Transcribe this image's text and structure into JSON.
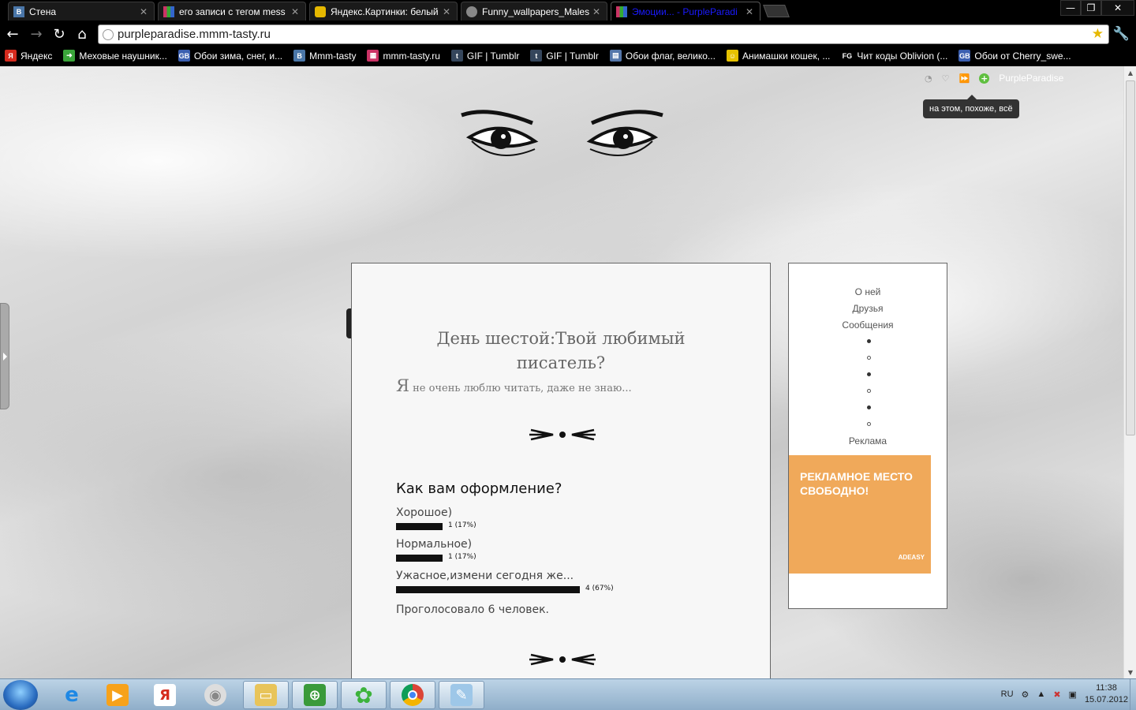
{
  "browser": {
    "tabs": [
      {
        "title": "Стена",
        "icon": "vk-icon",
        "color": "#4a76a8",
        "glyph": "В"
      },
      {
        "title": "его записи с тегом mess -",
        "icon": "mmm-tasty-icon",
        "color": "#cc3366",
        "glyph": ""
      },
      {
        "title": "Яндекс.Картинки: белый",
        "icon": "yandex-images-icon",
        "color": "#e6b800",
        "glyph": ""
      },
      {
        "title": "Funny_wallpapers_Males_a",
        "icon": "globe-icon",
        "color": "#888888",
        "glyph": ""
      },
      {
        "title": "Эмоции... - PurpleParadi",
        "icon": "mmm-tasty-icon",
        "color": "#cc3366",
        "glyph": ""
      }
    ],
    "address": "purpleparadise.mmm-tasty.ru",
    "bookmarks": [
      {
        "label": "Яндекс",
        "icon": "yandex-icon",
        "color": "#d52b1e",
        "glyph": "Я"
      },
      {
        "label": "Меховые наушник...",
        "icon": "green-arrow-icon",
        "color": "#3aa53a",
        "glyph": "➜"
      },
      {
        "label": "Обои зима, снег, и...",
        "icon": "wallpaper-site-icon",
        "color": "#3b5fb0",
        "glyph": "GB"
      },
      {
        "label": "Mmm-tasty",
        "icon": "vk-icon",
        "color": "#4a76a8",
        "glyph": "В"
      },
      {
        "label": "mmm-tasty.ru",
        "icon": "mmm-tasty-icon",
        "color": "#cc3366",
        "glyph": "▦"
      },
      {
        "label": "GIF | Tumblr",
        "icon": "tumblr-icon",
        "color": "#35465c",
        "glyph": "t"
      },
      {
        "label": "GIF | Tumblr",
        "icon": "tumblr-icon",
        "color": "#35465c",
        "glyph": "t"
      },
      {
        "label": "Обои флаг, велико...",
        "icon": "calendar-icon",
        "color": "#5577aa",
        "glyph": "▤"
      },
      {
        "label": "Анимашки кошек, ...",
        "icon": "smiley-icon",
        "color": "#e6c200",
        "glyph": "☺"
      },
      {
        "label": "Чит коды Oblivion (...",
        "icon": "fg-icon",
        "color": "#000000",
        "glyph": "FG"
      },
      {
        "label": "Обои от Cherry_swe...",
        "icon": "wallpaper-site-icon",
        "color": "#3b5fb0",
        "glyph": "GB"
      }
    ]
  },
  "page": {
    "top_user": "PurpleParadise",
    "tooltip": "на этом, похоже, всё",
    "post": {
      "title": "День шестой:Твой любимый писатель?",
      "intro_cap": "Я",
      "intro_rest": " не очень люблю читать, даже не знаю...",
      "poll": {
        "question": "Как вам оформление?",
        "options": [
          {
            "label": "Хорошое)",
            "value": "1 (17%)",
            "percent": 17
          },
          {
            "label": "Нормальное)",
            "value": "1 (17%)",
            "percent": 17
          },
          {
            "label": "Ужасное,измени сегодня же...",
            "value": "4 (67%)",
            "percent": 67
          }
        ],
        "total": "Проголосовало 6 человек."
      }
    },
    "sidebar": {
      "links": [
        "О ней",
        "Друзья",
        "Сообщения"
      ],
      "ad_label": "Реклама",
      "ad_text": "РЕКЛАМНОЕ МЕСТО СВОБОДНО!",
      "ad_brand": "ADEASY",
      "ad_color": "#f0a95a"
    }
  },
  "taskbar": {
    "lang": "RU",
    "time": "11:38",
    "date": "15.07.2012"
  }
}
